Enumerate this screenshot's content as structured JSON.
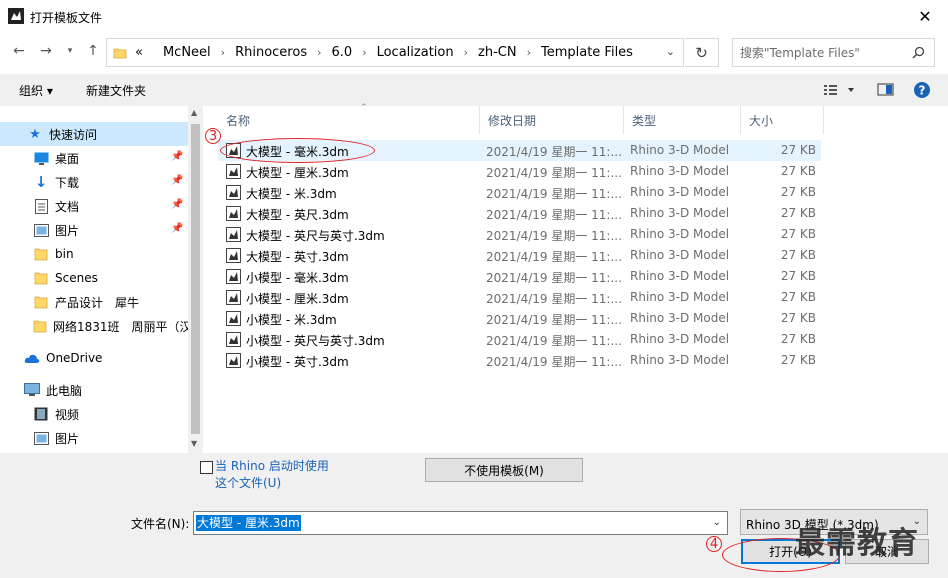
{
  "window": {
    "title": "打开模板文件",
    "close_label": "✕"
  },
  "address": {
    "crumbs": [
      "McNeel",
      "Rhinoceros",
      "6.0",
      "Localization",
      "zh-CN",
      "Template Files"
    ],
    "prefix": "«",
    "search_placeholder": "搜索\"Template Files\""
  },
  "toolbar": {
    "organize": "组织 ▾",
    "new_folder": "新建文件夹"
  },
  "nav": {
    "items": [
      {
        "label": "快速访问",
        "icon": "star-icon"
      },
      {
        "label": "桌面",
        "icon": "desktop-icon",
        "pinned": true
      },
      {
        "label": "下载",
        "icon": "download-icon",
        "pinned": true
      },
      {
        "label": "文档",
        "icon": "document-icon",
        "pinned": true
      },
      {
        "label": "图片",
        "icon": "picture-icon",
        "pinned": true
      },
      {
        "label": "bin",
        "icon": "folder-icon"
      },
      {
        "label": "Scenes",
        "icon": "folder-icon"
      },
      {
        "label": "产品设计　犀牛",
        "icon": "folder-icon"
      },
      {
        "label": "网络1831班　周丽平（汉",
        "icon": "folder-icon"
      },
      {
        "label": "OneDrive",
        "icon": "cloud-icon"
      },
      {
        "label": "此电脑",
        "icon": "computer-icon"
      },
      {
        "label": "视频",
        "icon": "video-icon"
      },
      {
        "label": "图片",
        "icon": "picture-icon"
      }
    ]
  },
  "files": {
    "columns": {
      "name": "名称",
      "date": "修改日期",
      "type": "类型",
      "size": "大小"
    },
    "rows": [
      {
        "name": "大模型 - 毫米.3dm",
        "date": "2021/4/19 星期一 11:...",
        "type": "Rhino 3-D Model",
        "size": "27 KB"
      },
      {
        "name": "大模型 - 厘米.3dm",
        "date": "2021/4/19 星期一 11:...",
        "type": "Rhino 3-D Model",
        "size": "27 KB"
      },
      {
        "name": "大模型 - 米.3dm",
        "date": "2021/4/19 星期一 11:...",
        "type": "Rhino 3-D Model",
        "size": "27 KB"
      },
      {
        "name": "大模型 - 英尺.3dm",
        "date": "2021/4/19 星期一 11:...",
        "type": "Rhino 3-D Model",
        "size": "27 KB"
      },
      {
        "name": "大模型 - 英尺与英寸.3dm",
        "date": "2021/4/19 星期一 11:...",
        "type": "Rhino 3-D Model",
        "size": "27 KB"
      },
      {
        "name": "大模型 - 英寸.3dm",
        "date": "2021/4/19 星期一 11:...",
        "type": "Rhino 3-D Model",
        "size": "27 KB"
      },
      {
        "name": "小模型 - 毫米.3dm",
        "date": "2021/4/19 星期一 11:...",
        "type": "Rhino 3-D Model",
        "size": "27 KB"
      },
      {
        "name": "小模型 - 厘米.3dm",
        "date": "2021/4/19 星期一 11:...",
        "type": "Rhino 3-D Model",
        "size": "27 KB"
      },
      {
        "name": "小模型 - 米.3dm",
        "date": "2021/4/19 星期一 11:...",
        "type": "Rhino 3-D Model",
        "size": "27 KB"
      },
      {
        "name": "小模型 - 英尺与英寸.3dm",
        "date": "2021/4/19 星期一 11:...",
        "type": "Rhino 3-D Model",
        "size": "27 KB"
      },
      {
        "name": "小模型 - 英寸.3dm",
        "date": "2021/4/19 星期一 11:...",
        "type": "Rhino 3-D Model",
        "size": "27 KB"
      }
    ]
  },
  "bottom": {
    "checkbox_label_line1": "当 Rhino 启动时使用",
    "checkbox_label_line2": "这个文件(U)",
    "no_template_button": "不使用模板(M)",
    "filename_label": "文件名(N):",
    "filename_value": "大模型 - 厘米.3dm",
    "filetype_value": "Rhino 3D 模型 (*.3dm)",
    "open_button": "打开(O)",
    "cancel_button": "取消"
  },
  "annotations": {
    "step3": "3",
    "step4": "4"
  },
  "watermark": "最需教育",
  "colors": {
    "selection": "#cce8ff",
    "hover_row": "#e5f3ff",
    "accent": "#0078d7",
    "annotation": "#e02020"
  }
}
